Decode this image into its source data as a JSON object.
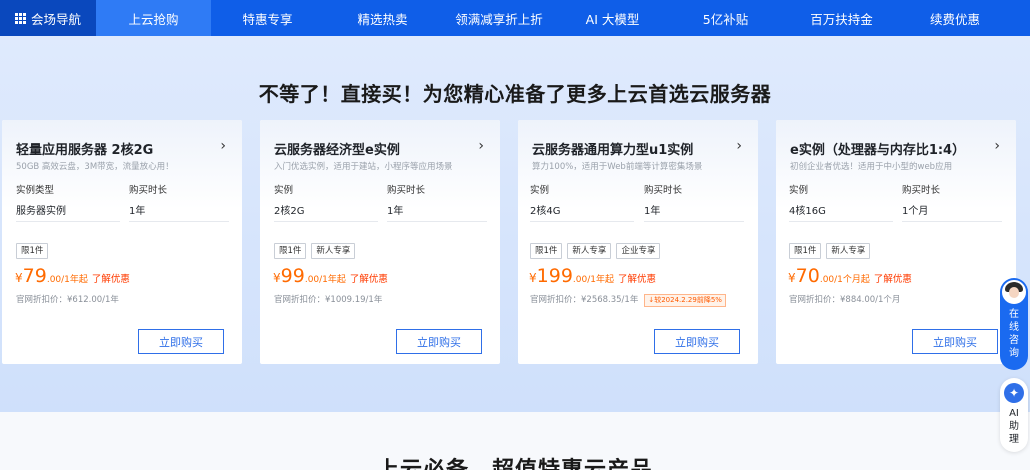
{
  "nav": {
    "items": [
      {
        "label": "会场导航",
        "icon": "grid-icon"
      },
      {
        "label": "上云抢购"
      },
      {
        "label": "特惠专享"
      },
      {
        "label": "精选热卖"
      },
      {
        "label": "领满减享折上折"
      },
      {
        "label": "AI 大模型"
      },
      {
        "label": "5亿补贴"
      },
      {
        "label": "百万扶持金"
      },
      {
        "label": "续费优惠"
      }
    ],
    "active_index": 1,
    "colors": {
      "bar": "#0f5ee8",
      "first": "#0a48bd",
      "active": "#2f7bf5"
    }
  },
  "headline": "不等了！直接买！为您精心准备了更多上云首选云服务器",
  "cards": [
    {
      "title": "轻量应用服务器 2核2G",
      "subtitle": "50GB 高效云盘，3M带宽，流量放心用！",
      "spec_label_1": "实例类型",
      "spec_value_1": "服务器实例",
      "spec_label_2": "购买时长",
      "spec_value_2": "1年",
      "tags": [
        "限1件"
      ],
      "price_currency": "¥",
      "price_value": "79",
      "price_unit": ".00/1年起",
      "price_link": "了解优惠",
      "original_price": "官网折扣价：¥612.00/1年",
      "promo": "",
      "buy_label": "立即购买"
    },
    {
      "title": "云服务器经济型e实例",
      "subtitle": "入门优选实例，适用于建站，小程序等应用场景",
      "spec_label_1": "实例",
      "spec_value_1": "2核2G",
      "spec_label_2": "购买时长",
      "spec_value_2": "1年",
      "tags": [
        "限1件",
        "新人专享"
      ],
      "price_currency": "¥",
      "price_value": "99",
      "price_unit": ".00/1年起",
      "price_link": "了解优惠",
      "original_price": "官网折扣价：¥1009.19/1年",
      "promo": "",
      "buy_label": "立即购买"
    },
    {
      "title": "云服务器通用算力型u1实例",
      "subtitle": "算力100%，适用于Web前端等计算密集场景",
      "spec_label_1": "实例",
      "spec_value_1": "2核4G",
      "spec_label_2": "购买时长",
      "spec_value_2": "1年",
      "tags": [
        "限1件",
        "新人专享",
        "企业专享"
      ],
      "price_currency": "¥",
      "price_value": "199",
      "price_unit": ".00/1年起",
      "price_link": "了解优惠",
      "original_price": "官网折扣价：¥2568.35/1年",
      "promo": "↓较2024.2.29前降5%",
      "buy_label": "立即购买"
    },
    {
      "title": "e实例（处理器与内存比1:4）",
      "subtitle": "初创企业者优选！适用于中小型的web应用",
      "spec_label_1": "实例",
      "spec_value_1": "4核16G",
      "spec_label_2": "购买时长",
      "spec_value_2": "1个月",
      "tags": [
        "限1件",
        "新人专享"
      ],
      "price_currency": "¥",
      "price_value": "70",
      "price_unit": ".00/1个月起",
      "price_link": "了解优惠",
      "original_price": "官网折扣价：¥884.00/1个月",
      "promo": "",
      "buy_label": "立即购买"
    }
  ],
  "bottom_title": "上云必备，超值特惠云产品",
  "float": {
    "consult_label": "在线咨询",
    "ai_label": "AI助理"
  },
  "colors": {
    "price": "#ff6a00",
    "link": "#ff3b00",
    "button": "#2f6fe8"
  }
}
